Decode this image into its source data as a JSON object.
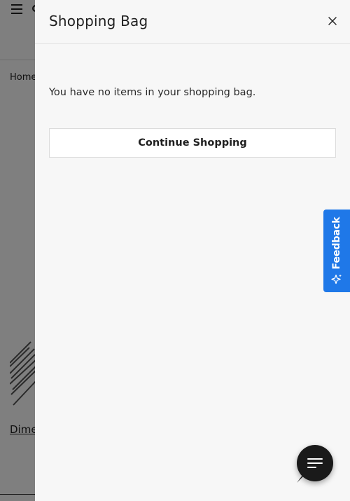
{
  "background": {
    "breadcrumb_text": "Home",
    "product_name": "Dime"
  },
  "drawer": {
    "title": "Shopping Bag",
    "close_icon": "close-icon",
    "empty_message": "You have no items in your shopping bag.",
    "continue_label": "Continue Shopping"
  },
  "feedback": {
    "label": "Feedback",
    "icon": "sparkle-star-icon",
    "color": "#1f78e8"
  },
  "chat": {
    "icon": "chat-lines-icon",
    "color": "#1a1a1a"
  }
}
